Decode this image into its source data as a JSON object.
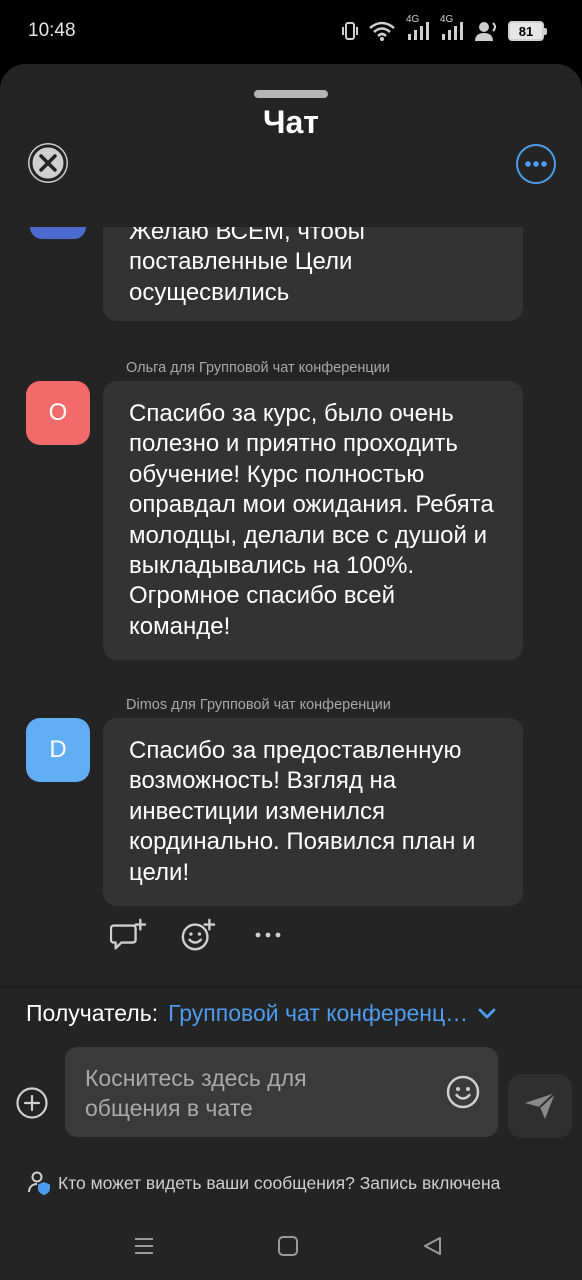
{
  "status_bar": {
    "time": "10:48",
    "net1": "4G",
    "net2": "4G",
    "battery": "81",
    "icons": [
      "vibrate-icon",
      "wifi-icon",
      "signal-icon",
      "signal-icon",
      "hotspot-icon",
      "battery-icon"
    ]
  },
  "header": {
    "title": "Чат"
  },
  "messages": [
    {
      "sender": "",
      "avatar_letter": "",
      "avatar_color": "#4b6bcf",
      "text": "Желаю ВСЕМ, чтобы поставленные Цели осущесвились"
    },
    {
      "sender": "Ольга для Групповой чат конференции",
      "avatar_letter": "О",
      "avatar_color": "#f26a6a",
      "text": "Спасибо за курс, было очень полезно и приятно проходить обучение! Курс полностью оправдал мои ожидания. Ребята молодцы, делали все с душой и выкладывались на 100%. Огромное спасибо всей команде!"
    },
    {
      "sender": "Dimos для Групповой чат конференции",
      "avatar_letter": "D",
      "avatar_color": "#62aef5",
      "text": "Спасибо за предоставленную возможность! Взгляд на инвестиции изменился кординально. Появился план и цели!"
    }
  ],
  "message_actions": {
    "more_label": "···"
  },
  "composer": {
    "recipient_label": "Получатель:",
    "recipient_value": "Групповой чат конференц…",
    "placeholder": "Коснитесь здесь для общения в чате",
    "privacy_text": "Кто может видеть ваши сообщения? Запись включена"
  },
  "colors": {
    "accent": "#4d9cf0",
    "sheet_bg": "#242424",
    "bubble_bg": "#333333"
  }
}
